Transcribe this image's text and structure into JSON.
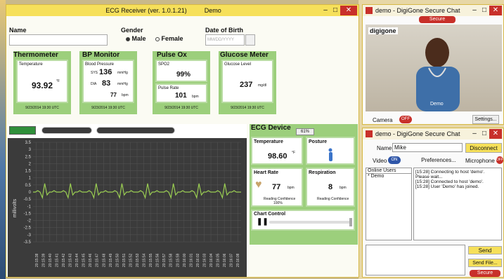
{
  "ecg_window": {
    "title": "ECG Receiver (ver. 1.0.1.21)",
    "demo_label": "Demo",
    "name_label": "Name",
    "gender_label": "Gender",
    "gender_male": "Male",
    "gender_female": "Female",
    "dob_label": "Date of Birth",
    "dob_placeholder": "MM/DD/YYYY",
    "thermometer": {
      "title": "Thermometer",
      "sub": "Temperature",
      "value": "93.92",
      "unit": "°F",
      "time": "9/23/2014 19:30 UTC"
    },
    "bp": {
      "title": "BP Monitor",
      "sub": "Blood Pressure",
      "sys_label": "SYS",
      "sys": "136",
      "dia_label": "DIA",
      "dia": "83",
      "pulse": "77",
      "unit_mmhg": "mmHg",
      "unit_bpm": "bpm",
      "time": "9/23/2014 19:30 UTC"
    },
    "pulse_ox": {
      "title": "Pulse Ox",
      "sub": "SPO2",
      "spo2": "99%",
      "rate_label": "Pulse Rate",
      "rate": "101",
      "unit": "bpm",
      "time": "9/23/2014 19:30 UTC"
    },
    "glucose": {
      "title": "Glucose Meter",
      "sub": "Glucose Level",
      "value": "237",
      "unit": "mg/dl",
      "time": "9/23/2014 19:30 UTC"
    },
    "ecg_device": {
      "title": "ECG Device",
      "battery": "61%",
      "temp_label": "Temperature",
      "temp": "98.60",
      "temp_unit": "°F",
      "posture_label": "Posture",
      "hr_label": "Heart Rate",
      "hr": "77",
      "hr_unit": "bpm",
      "hr_conf": "Reading Confidence",
      "hr_conf_val": "100%",
      "resp_label": "Respiration",
      "resp": "8",
      "resp_unit": "bpm",
      "resp_conf": "Reading Confidence",
      "chart_control": "Chart Control"
    },
    "chart_data": {
      "type": "line",
      "ylabel": "millivolts",
      "ylim": [
        -3.5,
        3.5
      ],
      "yticks": [
        "3.5",
        "3",
        "2.5",
        "2",
        "1.5",
        "1",
        "0.5",
        "0",
        "-0.5",
        "-1",
        "-1.5",
        "-2",
        "-2.5",
        "-3",
        "-3.5"
      ],
      "xticks": [
        "20:15:38",
        "20:15:39",
        "20:15:40",
        "20:15:41",
        "20:15:42",
        "20:15:43",
        "20:15:44",
        "20:15:45",
        "20:15:46",
        "20:15:47",
        "20:15:48",
        "20:15:49",
        "20:15:50",
        "20:15:51",
        "20:15:52",
        "20:15:53",
        "20:15:54",
        "20:15:55",
        "20:15:56",
        "20:15:57",
        "20:15:58",
        "20:15:59",
        "20:16:00",
        "20:16:01",
        "20:16:02",
        "20:16:03",
        "20:16:04",
        "20:16:05",
        "20:16:06",
        "20:16:07",
        "20:16:08"
      ],
      "grid": true,
      "series": [
        {
          "values": [
            0,
            0,
            0.1,
            0,
            -0.4,
            0.6,
            -0.2,
            0,
            0,
            0.1,
            0,
            0,
            0,
            0.1,
            0,
            -0.4,
            0.6,
            -0.2,
            0,
            0,
            0.1,
            0,
            0,
            0,
            0.1,
            0,
            -0.4,
            0.6,
            -0.2,
            0,
            0,
            0.1,
            0,
            0,
            0,
            0.1,
            0,
            -0.4,
            0.6,
            -0.2,
            0,
            0,
            0.1,
            0,
            0,
            0,
            0.1,
            0,
            -0.4,
            0.6,
            -0.2,
            0,
            0,
            0.1,
            0,
            0,
            0,
            0.1,
            0,
            -0.4,
            0.6,
            -0.2,
            0,
            0,
            0.1,
            0,
            0,
            0,
            0.1,
            0,
            -0.4,
            0.6,
            -0.2,
            0,
            0,
            0.1,
            0,
            0,
            0,
            0.1,
            0,
            -0.4,
            0.6,
            -0.2,
            0,
            0,
            0.1,
            0,
            0,
            0
          ]
        }
      ],
      "line_color": "#9acd52",
      "bg_color": "#3b3b3b"
    }
  },
  "video_window": {
    "title": "demo - DigiGone Secure Chat",
    "secure": "Secure",
    "logo": "digigone",
    "caller": "Demo",
    "camera": "Camera",
    "off": "OFF",
    "settings": "Settings..."
  },
  "chat_window": {
    "title": "demo - DigiGone Secure Chat",
    "name_label": "Name:",
    "name_value": "Mike",
    "disconnect": "Disconnect",
    "video_label": "Video",
    "video_state": "ON",
    "preferences": "Preferences...",
    "microphone": "Microphone",
    "mic_state": "OFF",
    "online_users": "Online Users",
    "users": [
      "* Demo"
    ],
    "messages": [
      "[15:28] Connecting to host 'demo'.",
      "Please wait...",
      "[15:28] Connected to host 'demo'.",
      "[15:28] User 'Demo' has joined."
    ],
    "send": "Send",
    "send_file": "Send File...",
    "secure": "Secure"
  }
}
